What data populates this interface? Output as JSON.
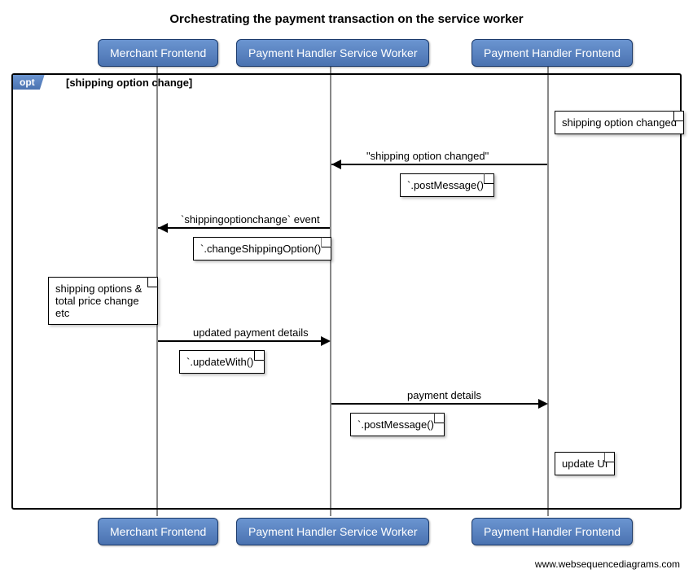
{
  "title": "Orchestrating the payment transaction on the service worker",
  "participants": {
    "merchant": "Merchant Frontend",
    "worker": "Payment Handler Service Worker",
    "frontend": "Payment Handler Frontend"
  },
  "opt": {
    "tag": "opt",
    "guard": "[shipping option change]"
  },
  "notes": {
    "n1": "shipping option changed",
    "n2": "`.postMessage()`",
    "n3": "`.changeShippingOption()`",
    "n4": "shipping options & total price change etc",
    "n5": "`.updateWith()`",
    "n6": "`.postMessage()`",
    "n7": "update UI"
  },
  "messages": {
    "m1": "\"shipping option changed\"",
    "m2": "`shippingoptionchange` event",
    "m3": "updated payment details",
    "m4": "payment details"
  },
  "watermark": "www.websequencediagrams.com",
  "chart_data": {
    "type": "sequence_diagram",
    "title": "Orchestrating the payment transaction on the service worker",
    "participants": [
      "Merchant Frontend",
      "Payment Handler Service Worker",
      "Payment Handler Frontend"
    ],
    "fragment": {
      "type": "opt",
      "guard": "shipping option change"
    },
    "events": [
      {
        "kind": "note",
        "over": "Payment Handler Frontend",
        "text": "shipping option changed"
      },
      {
        "kind": "message",
        "from": "Payment Handler Frontend",
        "to": "Payment Handler Service Worker",
        "label": "\"shipping option changed\""
      },
      {
        "kind": "note",
        "over": "Payment Handler Service Worker",
        "text": ".postMessage()"
      },
      {
        "kind": "message",
        "from": "Payment Handler Service Worker",
        "to": "Merchant Frontend",
        "label": "`shippingoptionchange` event"
      },
      {
        "kind": "note",
        "over": "Payment Handler Service Worker",
        "text": ".changeShippingOption()"
      },
      {
        "kind": "note",
        "over": "Merchant Frontend",
        "text": "shipping options & total price change etc"
      },
      {
        "kind": "message",
        "from": "Merchant Frontend",
        "to": "Payment Handler Service Worker",
        "label": "updated payment details"
      },
      {
        "kind": "note",
        "over": "Merchant Frontend",
        "text": ".updateWith()"
      },
      {
        "kind": "message",
        "from": "Payment Handler Service Worker",
        "to": "Payment Handler Frontend",
        "label": "payment details"
      },
      {
        "kind": "note",
        "over": "Payment Handler Service Worker",
        "text": ".postMessage()"
      },
      {
        "kind": "note",
        "over": "Payment Handler Frontend",
        "text": "update UI"
      }
    ]
  }
}
